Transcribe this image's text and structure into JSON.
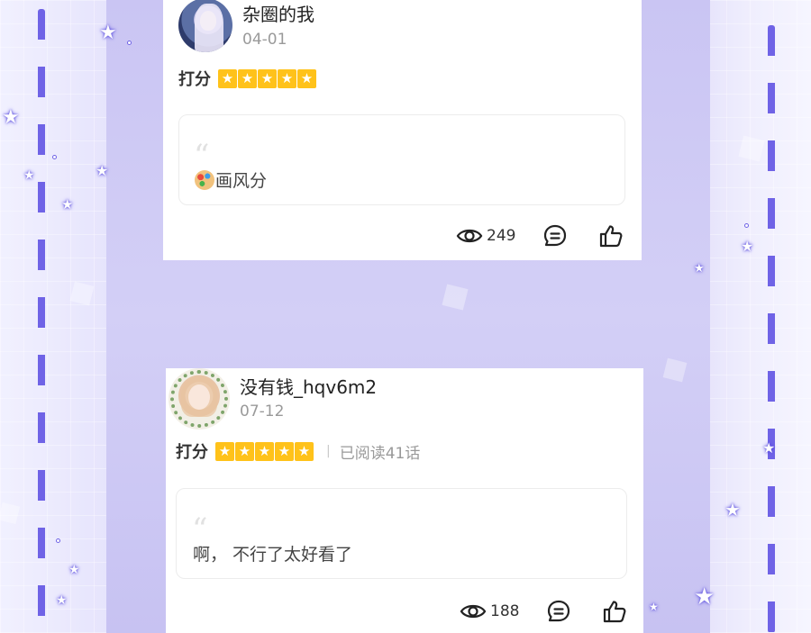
{
  "comments": [
    {
      "username": "杂圈的我",
      "date": "04-01",
      "rating_label": "打分",
      "rating_stars": 5,
      "read_info": "",
      "quote_mark": "“",
      "comment_icon": "palette-emoji-icon",
      "comment_text": "画风分",
      "views": "249"
    },
    {
      "username": "没有钱_hqv6m2",
      "date": "07-12",
      "rating_label": "打分",
      "rating_stars": 5,
      "read_separator": "|",
      "read_info": "已阅读41话",
      "quote_mark": "“",
      "comment_text": "啊， 不行了太好看了",
      "views": "188"
    }
  ],
  "icons": {
    "views": "eye-icon",
    "reply": "comment-icon",
    "like": "thumbs-up-icon",
    "star": "star-icon"
  },
  "colors": {
    "star_fill": "#ffc21a",
    "accent_purple": "#6f63e6"
  }
}
